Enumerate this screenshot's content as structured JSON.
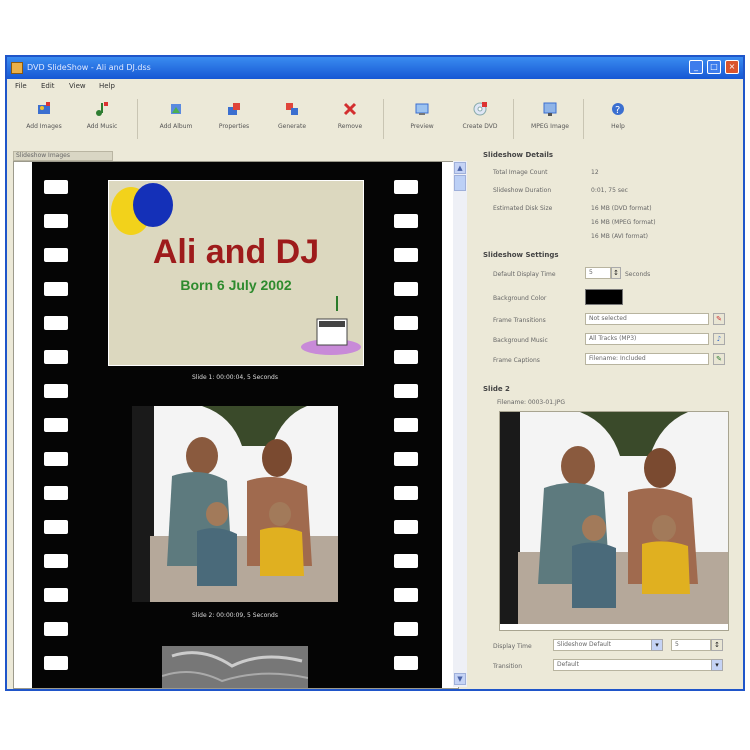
{
  "window": {
    "title": "DVD SlideShow - Ali and DJ.dss"
  },
  "menu": [
    "File",
    "Edit",
    "View",
    "Help"
  ],
  "toolbar": [
    {
      "label": "Add Images",
      "icon": "add-images-icon"
    },
    {
      "label": "Add Music",
      "icon": "add-music-icon"
    },
    {
      "label": "Add Album",
      "icon": "add-album-icon"
    },
    {
      "label": "Properties",
      "icon": "properties-icon"
    },
    {
      "label": "Generate",
      "icon": "generate-icon"
    },
    {
      "label": "Remove",
      "icon": "remove-icon"
    },
    {
      "label": "Preview",
      "icon": "preview-icon"
    },
    {
      "label": "Create DVD",
      "icon": "create-dvd-icon"
    },
    {
      "label": "MPEG Image",
      "icon": "mpeg-image-icon"
    },
    {
      "label": "Help",
      "icon": "help-icon"
    }
  ],
  "left_tab": "Slideshow Images",
  "filmstrip": {
    "title_slide": {
      "heading": "Ali and DJ",
      "subheading": "Born 6 July 2002"
    },
    "captions": [
      "Slide 1: 00:00:04, 5 Seconds",
      "Slide 2: 00:00:09, 5 Seconds"
    ]
  },
  "slideshow_info": {
    "header": "Slideshow Details",
    "rows": [
      {
        "label": "Total Image Count",
        "value": "12"
      },
      {
        "label": "Slideshow Duration",
        "value": "0:01, 75 sec"
      },
      {
        "label": "Estimated Disk Size",
        "value": "16 MB (DVD format)"
      }
    ],
    "extra_lines": [
      "16 MB (MPEG format)",
      "16 MB (AVI format)"
    ]
  },
  "slideshow_settings": {
    "header": "Slideshow Settings",
    "default_time_label": "Default Display Time",
    "default_time_value": "5",
    "default_time_unit": "Seconds",
    "bg_label": "Background Color",
    "bg_color": "#000000",
    "transitions_label": "Frame Transitions",
    "transitions_value": "Not selected",
    "bg_music_label": "Background Music",
    "bg_music_value": "All Tracks (MP3)",
    "captions_label": "Frame Captions",
    "captions_value": "Filename: Included"
  },
  "slide": {
    "header": "Slide 2",
    "filename": "Filename: 0003-01.JPG",
    "display_time_label": "Display Time",
    "display_time_value": "Slideshow Default",
    "display_secs": "5",
    "transition_label": "Transition",
    "transition_value": "Default"
  }
}
